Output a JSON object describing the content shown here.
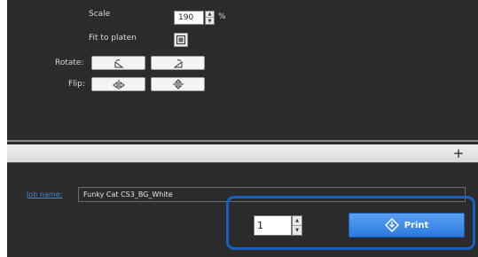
{
  "layout_panel": {
    "scale_label": "Scale",
    "scale_value": "190",
    "scale_unit": "%",
    "fit_label": "Fit to platen",
    "rotate_label": "Rotate:",
    "flip_label": "Flip:"
  },
  "toolbar": {
    "add_symbol": "+"
  },
  "job": {
    "name_label": "Job name:",
    "name_value": "Funky Cat CS3_BG_White"
  },
  "print_area": {
    "copies": "1",
    "print_label": "Print"
  },
  "colors": {
    "highlight": "#1660c6",
    "print_button": "#3a8aec",
    "dark_panel": "#2b2b2b"
  }
}
